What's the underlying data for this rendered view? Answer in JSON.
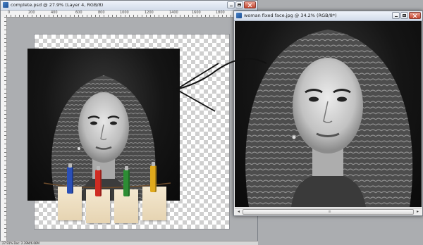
{
  "left_window": {
    "title": "complete.psd @ 27.9% (Layer 4, RGB/8)",
    "ruler_marks": [
      "0",
      "200",
      "400",
      "600",
      "800",
      "1000",
      "1200",
      "1400",
      "1600",
      "1800"
    ]
  },
  "right_window": {
    "title": "woman fixed face.jpg @ 34.2% (RGB/8*)"
  },
  "status_bar": {
    "text": "27.91%   Doc: 2.39M/6.66M"
  },
  "colors": {
    "clip_blue": "#2a4fb7",
    "clip_red": "#cf2c23",
    "clip_green": "#2d8d34",
    "clip_yellow": "#e0a91c",
    "window_chrome": "#f0f0f0",
    "workspace": "#abadb0"
  },
  "icons": [
    "minimize-icon",
    "maximize-icon",
    "close-icon",
    "scroll-left-icon",
    "scroll-right-icon",
    "document-icon"
  ]
}
